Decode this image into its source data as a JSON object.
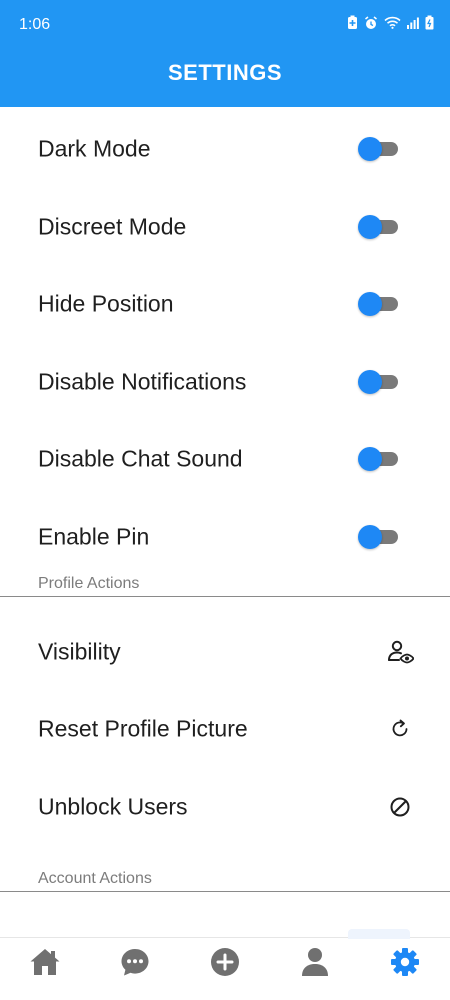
{
  "status_bar": {
    "time": "1:06",
    "icons": [
      "battery-saver-icon",
      "alarm-icon",
      "wifi-icon",
      "signal-icon",
      "battery-icon"
    ]
  },
  "header": {
    "title": "SETTINGS",
    "background_color": "#2196f3"
  },
  "toggles": [
    {
      "label": "Dark Mode",
      "enabled": false
    },
    {
      "label": "Discreet Mode",
      "enabled": false
    },
    {
      "label": "Hide Position",
      "enabled": false
    },
    {
      "label": "Disable Notifications",
      "enabled": false
    },
    {
      "label": "Disable Chat Sound",
      "enabled": false
    },
    {
      "label": "Enable Pin",
      "enabled": false
    }
  ],
  "profile_actions": {
    "section_label": "Profile Actions",
    "items": [
      {
        "label": "Visibility",
        "icon": "user-eye-icon"
      },
      {
        "label": "Reset Profile Picture",
        "icon": "refresh-icon"
      },
      {
        "label": "Unblock Users",
        "icon": "block-icon"
      }
    ]
  },
  "account_actions": {
    "section_label": "Account Actions"
  },
  "bottom_nav": {
    "items": [
      {
        "name": "home",
        "icon": "home-icon",
        "active": false
      },
      {
        "name": "chat",
        "icon": "chat-icon",
        "active": false
      },
      {
        "name": "add",
        "icon": "plus-circle-icon",
        "active": false
      },
      {
        "name": "profile",
        "icon": "person-icon",
        "active": false
      },
      {
        "name": "settings",
        "icon": "gear-icon",
        "active": true
      }
    ],
    "active_color": "#1e88f5",
    "inactive_color": "#707070"
  },
  "colors": {
    "accent": "#1e88f5",
    "toggle_track": "#7a7a7a",
    "section_label": "#7c7c7c"
  }
}
